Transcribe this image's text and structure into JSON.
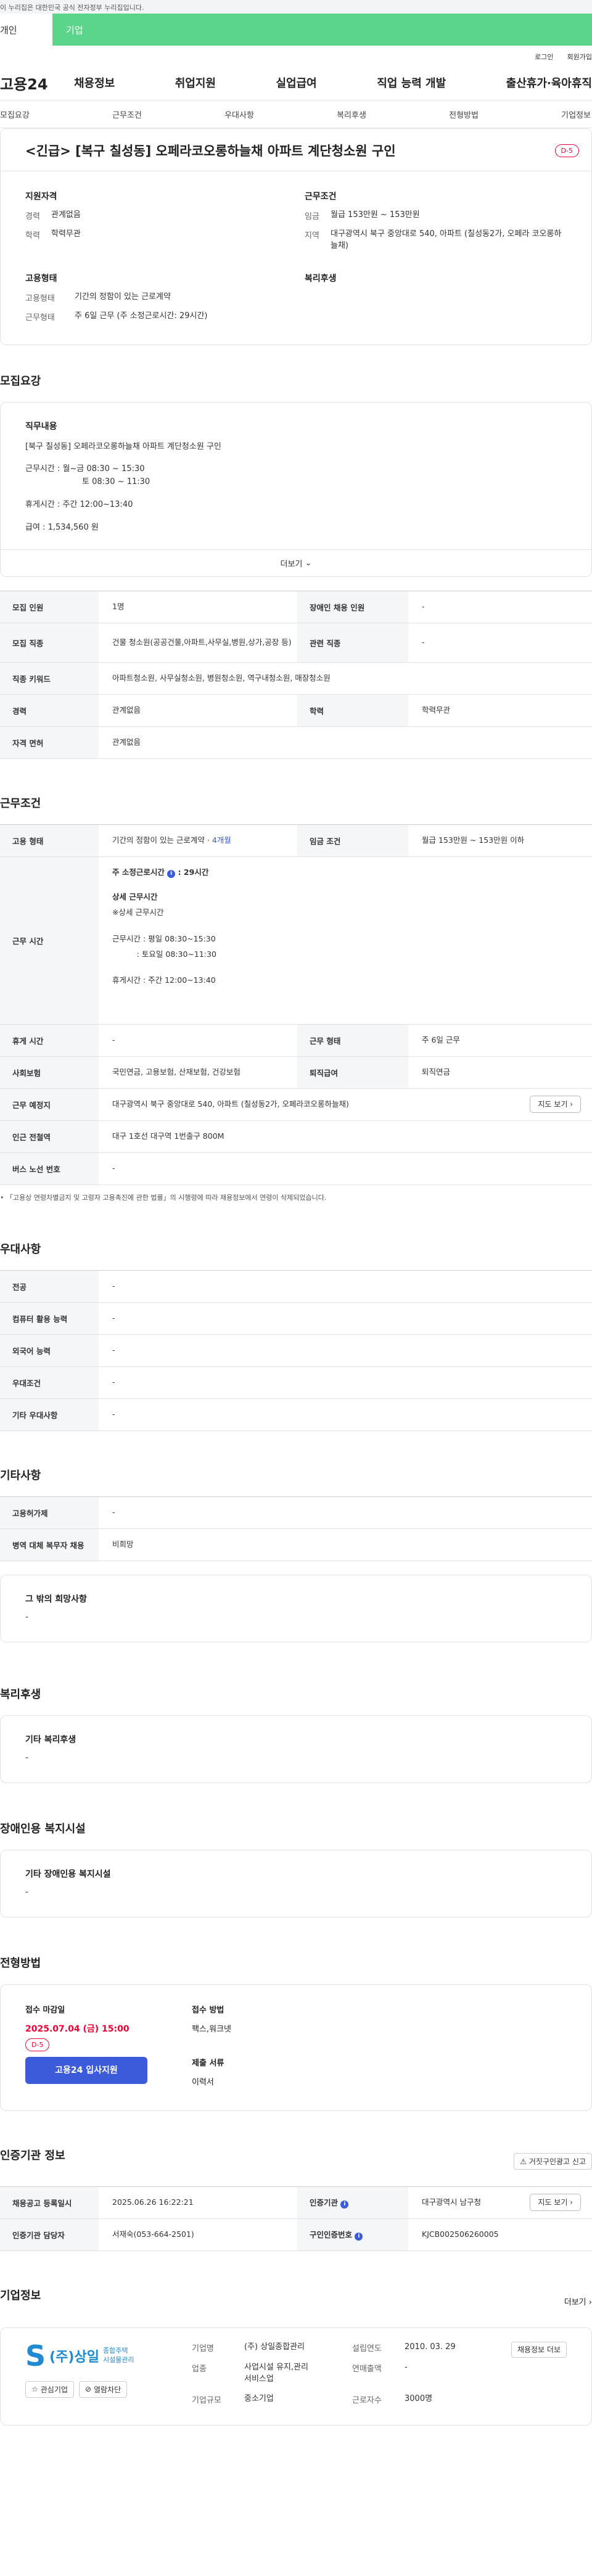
{
  "gov_banner": "이 누리집은 대한민국 공식 전자정부 누리집입니다.",
  "user_tabs": [
    "개인",
    "기업"
  ],
  "util_links": [
    "로그인",
    "회원가입"
  ],
  "site": {
    "logo": "고용24"
  },
  "gnb": [
    "채용정보",
    "취업지원",
    "실업급여",
    "직업 능력 개발",
    "출산휴가·육아휴직"
  ],
  "subnav": [
    "모집요강",
    "근무조건",
    "우대사항",
    "복리후생",
    "전형방법",
    "기업정보"
  ],
  "summary": {
    "title": "<긴급> [복구 칠성동] 오페라코오롱하늘채 아파트 계단청소원 구인",
    "dday": "D-5",
    "qual_title": "지원자격",
    "qual": [
      {
        "k": "경력",
        "v": "관계없음"
      },
      {
        "k": "학력",
        "v": "학력무관"
      }
    ],
    "work_title": "근무조건",
    "work": [
      {
        "k": "임금",
        "v": "월급 153만원 ~ 153만원"
      },
      {
        "k": "지역",
        "v": "대구광역시 북구 중앙대로 540, 아파트 (칠성동2가, 오페라 코오롱하늘채)"
      }
    ],
    "emp_title": "고용형태",
    "emp": [
      {
        "k": "고용형태",
        "v": "기간의 정함이 있는 근로계약"
      },
      {
        "k": "근무형태",
        "v": "주 6일 근무 (주 소정근로시간: 29시간)"
      }
    ],
    "welfare_title": "복리후생"
  },
  "recruit": {
    "title": "모집요강",
    "job_label": "직무내용",
    "lines": [
      "[북구 칠성동] 오페라코오롱하늘채 아파트 계단청소원 구인",
      "근무시간 : 월~금 08:30 ~ 15:30",
      "토 08:30 ~ 11:30",
      "휴게시간 : 주간 12:00~13:40",
      "급여 : 1,534,560 원"
    ],
    "more": "더보기",
    "rows": [
      {
        "k1": "모집 인원",
        "v1": "1명",
        "k2": "장애인 채용 인원",
        "v2": "-"
      },
      {
        "k1": "모집 직종",
        "v1": "건물 청소원(공공건물,아파트,사무실,병원,상가,공장 등)",
        "k2": "관련 직종",
        "v2": "-"
      },
      {
        "k1": "직종 키워드",
        "v1": "아파트청소원, 사무실청소원, 병원청소원, 역구내청소원, 매장청소원"
      },
      {
        "k1": "경력",
        "v1": "관계없음",
        "k2": "학력",
        "v2": "학력무관"
      },
      {
        "k1": "자격 면허",
        "v1": "관계없음"
      }
    ]
  },
  "work": {
    "title": "근무조건",
    "emp_type_k": "고용 형태",
    "emp_type_v": "기간의 정함이 있는 근로계약 · ",
    "emp_type_months": "4개월",
    "wage_k": "임금 조건",
    "wage_v": "월급 153만원 ~ 153만원 이하",
    "hours_k": "근무 시간",
    "hours_week": "주 소정근로시간",
    "hours_week_v": ": 29시간",
    "hours_detail_title": "상세 근무시간",
    "hours_detail_sub": "※상세 근무시간",
    "hours_lines": [
      "근무시간 : 평일 08:30~15:30",
      "          : 토요일 08:30~11:30",
      "휴게시간 : 주간 12:00~13:40"
    ],
    "break_k": "휴게 시간",
    "break_v": "-",
    "form_k": "근무 형태",
    "form_v": "주 6일 근무",
    "ins_k": "사회보험",
    "ins_v": "국민연금, 고용보험, 산재보험, 건강보험",
    "sev_k": "퇴직급여",
    "sev_v": "퇴직연금",
    "place_k": "근무 예정지",
    "place_v": "대구광역시 북구 중앙대로 540, 아파트 (칠성동2가, 오페라코오롱하늘채)",
    "map_btn": "지도 보기",
    "station_k": "인근 전철역",
    "station_v": "대구 1호선 대구역 1번출구 800M",
    "bus_k": "버스 노선 번호",
    "bus_v": "-",
    "note": "「고용상 연령차별금지 및 고령자 고용촉진에 관한 법률」의 시행령에 따라 채용정보에서 연령이 삭제되었습니다."
  },
  "pref": {
    "title": "우대사항",
    "rows": [
      {
        "k": "전공",
        "v": "-"
      },
      {
        "k": "컴퓨터 활용 능력",
        "v": "-"
      },
      {
        "k": "외국어 능력",
        "v": "-"
      },
      {
        "k": "우대조건",
        "v": "-"
      },
      {
        "k": "기타 우대사항",
        "v": "-"
      }
    ]
  },
  "etc": {
    "title": "기타사항",
    "rows": [
      {
        "k": "고용허가제",
        "v": "-"
      },
      {
        "k": "병역 대체 복무자 채용",
        "v": "비희망"
      }
    ],
    "other_label": "그 밖의 희망사항",
    "other_value": "-"
  },
  "welfare": {
    "title": "복리후생",
    "label": "기타 복리후생",
    "value": "-"
  },
  "disabled": {
    "title": "장애인용 복지시설",
    "label": "기타 장애인용 복지시설",
    "value": "-"
  },
  "screening": {
    "title": "전형방법",
    "deadline_label": "접수 마감일",
    "deadline": "2025.07.04 (금) 15:00",
    "dday": "D-5",
    "apply_btn": "고용24 입사지원",
    "method_label": "접수 방법",
    "method_value": "팩스,워크넷",
    "docs_label": "제출 서류",
    "docs_value": "이력서"
  },
  "org": {
    "title": "인증기관 정보",
    "report_btn": "거짓구인광고 신고",
    "reg_k": "채용공고 등록일시",
    "reg_v": "2025.06.26 16:22:21",
    "org_k": "인증기관",
    "org_v": "대구광역시 남구청",
    "map_btn": "지도 보기",
    "mgr_k": "인증기관 담당자",
    "mgr_v": "서재숙(053-664-2501)",
    "cert_k": "구인인증번호",
    "cert_v": "KJCB002506260005"
  },
  "company": {
    "title": "기업정보",
    "more": "더보기",
    "logo_letter": "S",
    "logo_name": "(주)상일",
    "logo_sub1": "종합주택",
    "logo_sub2": "시설물관리",
    "fav_btn": "관심기업",
    "block_btn": "열람차단",
    "info": [
      {
        "k": "기업명",
        "v": "(주) 상일종합관리"
      },
      {
        "k": "설립연도",
        "v": "2010. 03. 29"
      },
      {
        "k": "업종",
        "v": "사업시설 유지,관리 서비스업"
      },
      {
        "k": "연매출액",
        "v": "-"
      },
      {
        "k": "기업규모",
        "v": "중소기업"
      },
      {
        "k": "근로자수",
        "v": "3000명"
      }
    ],
    "jobs_btn": "채용정보 더보"
  }
}
